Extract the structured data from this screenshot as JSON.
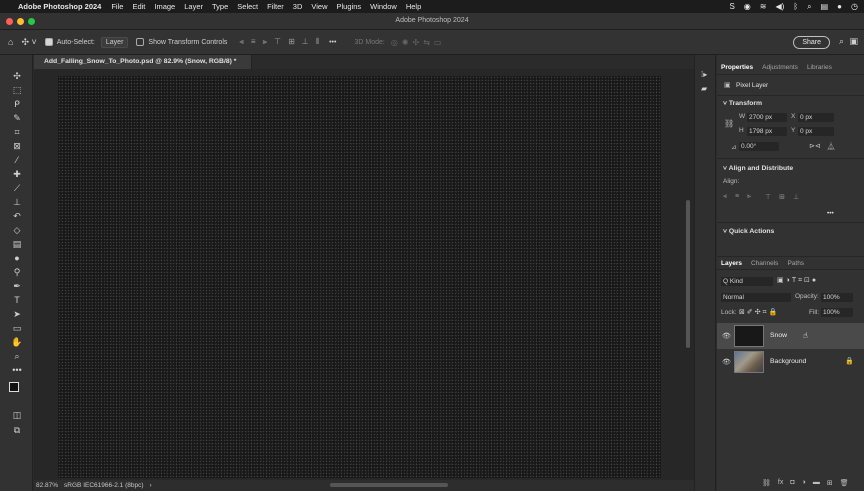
{
  "menubar": {
    "apple": "",
    "app_name": "Adobe Photoshop 2024",
    "items": [
      "File",
      "Edit",
      "Image",
      "Layer",
      "Type",
      "Select",
      "Filter",
      "3D",
      "View",
      "Plugins",
      "Window",
      "Help"
    ]
  },
  "window": {
    "title": "Adobe Photoshop 2024"
  },
  "options": {
    "auto_select_label": "Auto-Select:",
    "auto_select_value": "Layer",
    "show_transform_label": "Show Transform Controls",
    "more": "•••",
    "mode_3d": "3D Mode:",
    "share_label": "Share"
  },
  "document": {
    "tab_title": "Add_Falling_Snow_To_Photo.psd @ 82.9% (Snow, RGB/8) *",
    "zoom": "82.87%",
    "color_profile": "sRGB IEC61966-2.1 (8bpc)",
    "status_arrow": "›"
  },
  "properties": {
    "tabs": [
      "Properties",
      "Adjustments",
      "Libraries"
    ],
    "layer_type": "Pixel Layer",
    "transform_title": "Transform",
    "w_label": "W",
    "w_value": "2700 px",
    "h_label": "H",
    "h_value": "1798 px",
    "x_label": "X",
    "x_value": "0 px",
    "y_label": "Y",
    "y_value": "0 px",
    "angle_value": "0.00°",
    "align_title": "Align and Distribute",
    "align_label": "Align:",
    "align_more": "•••",
    "quick_actions_title": "Quick Actions"
  },
  "layers": {
    "tabs": [
      "Layers",
      "Channels",
      "Paths"
    ],
    "kind_label": "Q Kind",
    "blend_mode": "Normal",
    "opacity_label": "Opacity:",
    "opacity_value": "100%",
    "lock_label": "Lock:",
    "fill_label": "Fill:",
    "fill_value": "100%",
    "items": [
      {
        "name": "Snow",
        "selected": true
      },
      {
        "name": "Background",
        "selected": false
      }
    ]
  },
  "colors": {
    "accent": "#3478f6",
    "canvas": "#171717",
    "panel": "#323232"
  }
}
